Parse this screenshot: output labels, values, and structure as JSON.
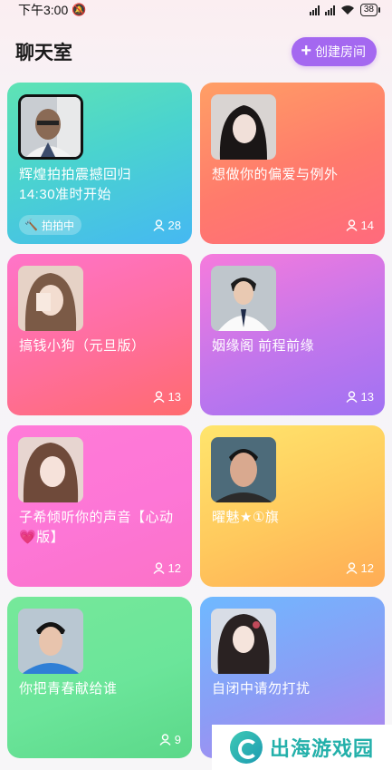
{
  "status_bar": {
    "time": "下午3:00",
    "battery": "38"
  },
  "header": {
    "title": "聊天室",
    "create_label": "创建房间"
  },
  "rooms": [
    {
      "name": "辉煌拍拍震撼回归\n14:30准时开始",
      "count": "28",
      "badge": "拍拍中",
      "bg": "bg1"
    },
    {
      "name": "想做你的偏爱与例外",
      "count": "14",
      "bg": "bg2"
    },
    {
      "name": "搞钱小狗（元旦版）",
      "count": "13",
      "bg": "bg3"
    },
    {
      "name": "姻缘阁 前程前缘",
      "count": "13",
      "bg": "bg4"
    },
    {
      "name": "子希倾听你的声音【心动💗版】",
      "count": "12",
      "bg": "bg5"
    },
    {
      "name": "曜魅★①旗",
      "count": "12",
      "bg": "bg6"
    },
    {
      "name": "你把青春献给谁",
      "count": "9",
      "bg": "bg7"
    },
    {
      "name": "自闭中请勿打扰",
      "count": "",
      "bg": "bg8"
    }
  ],
  "watermark": {
    "text": "出海游戏园"
  },
  "colors": {
    "accent": "#a468f0"
  }
}
